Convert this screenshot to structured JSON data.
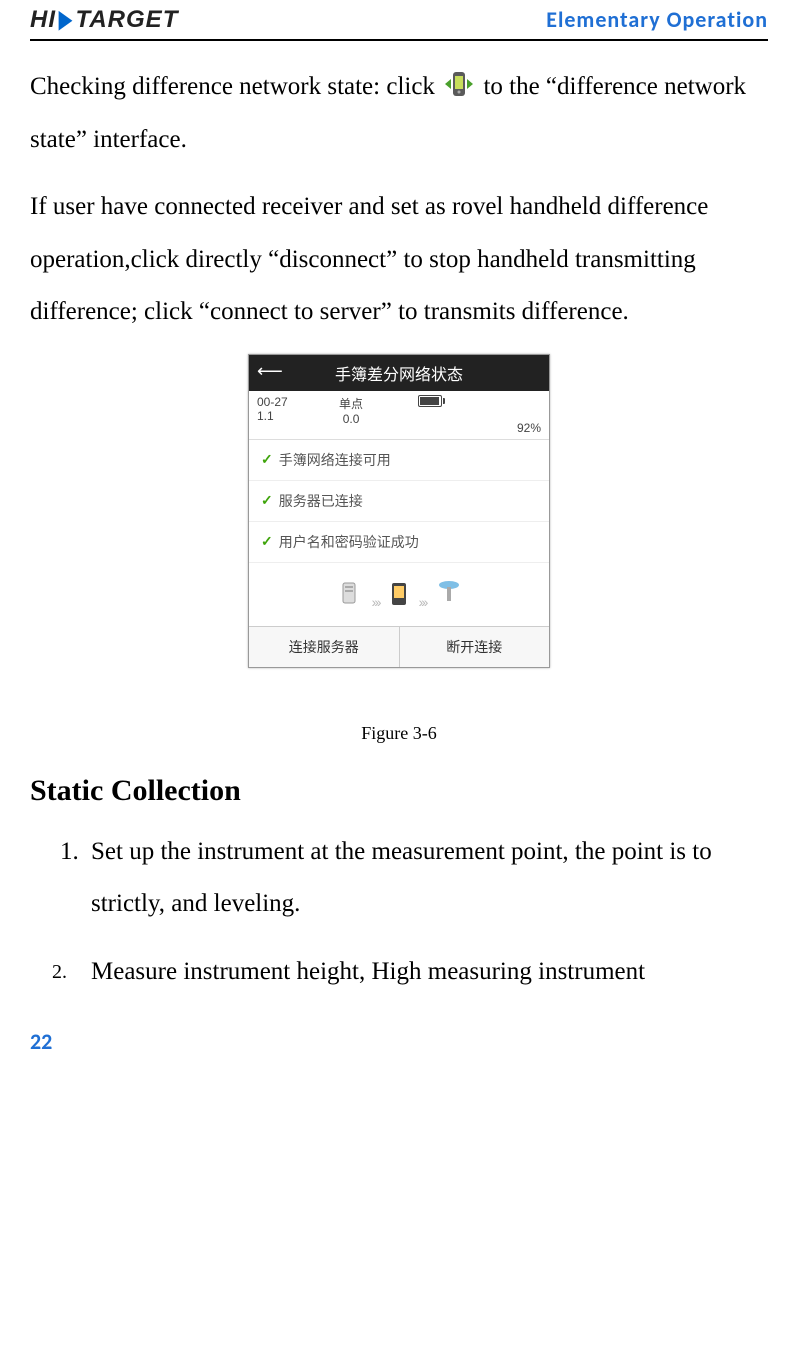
{
  "header": {
    "logo_text_1": "HI",
    "logo_text_2": "TARGET",
    "section_title": "Elementary  Operation"
  },
  "para1_a": "Checking difference network state: click ",
  "para1_b": "to the “difference network state” interface.",
  "para2": "If user have connected receiver and set as rovel handheld difference operation,click directly “disconnect” to stop handheld transmitting difference; click “connect to server” to transmits difference.",
  "screenshot": {
    "title": "手簿差分网络状态",
    "status_bar": {
      "col1_top": "00-27",
      "col1_bot": "1.1",
      "center_top": "单点",
      "center_bot": "0.0",
      "battery": "92%"
    },
    "items": [
      "手簿网络连接可用",
      "服务器已连接",
      "用户名和密码验证成功"
    ],
    "btn_left": "连接服务器",
    "btn_right": "断开连接"
  },
  "figure_caption": "Figure 3-6",
  "heading": "Static Collection",
  "list": {
    "item1": "Set up the instrument at the measurement point, the point is to strictly, and leveling.",
    "item2": "Measure instrument height, High measuring instrument"
  },
  "page_number": "22"
}
